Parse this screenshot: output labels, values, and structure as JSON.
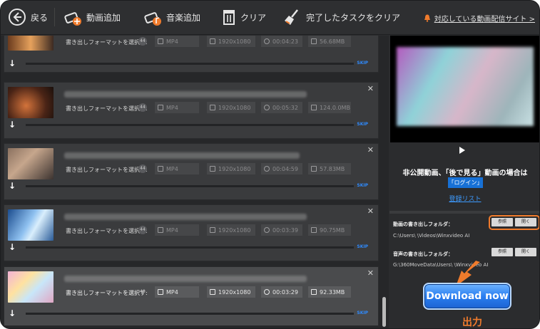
{
  "toolbar": {
    "back_label": "戻る",
    "add_video_label": "動画追加",
    "add_music_label": "音楽追加",
    "clear_label": "クリア",
    "clear_done_label": "完了したタスクをクリア",
    "sites_link": "対応している動画配信サイト >"
  },
  "tasks": [
    {
      "format_select": "書き出しフォーマットを選択す:",
      "badge": "44",
      "format": "MP4",
      "resolution": "1920x1080",
      "duration": "00:04:23",
      "size": "56.68MB",
      "skip": "SKIP"
    },
    {
      "format_select": "書き出しフォーマットを選択す:",
      "badge": "44",
      "format": "MP4",
      "resolution": "1920x1080",
      "duration": "00:05:32",
      "size": "124.0.0MB",
      "skip": "SKIP"
    },
    {
      "format_select": "書き出しフォーマットを選択す:",
      "badge": "44",
      "format": "MP4",
      "resolution": "1920x1080",
      "duration": "00:04:59",
      "size": "57.83MB",
      "skip": "SKIP"
    },
    {
      "format_select": "書き出しフォーマットを選択す:",
      "badge": "44",
      "format": "MP4",
      "resolution": "1920x1080",
      "duration": "00:03:39",
      "size": "90.75MB",
      "skip": "SKIP"
    },
    {
      "format_select": "書き出しフォーマットを選択す:",
      "badge": "43",
      "format": "MP4",
      "resolution": "1920x1080",
      "duration": "00:03:29",
      "size": "92.33MB",
      "skip": "SKIP"
    }
  ],
  "right_panel": {
    "notice": "非公開動画、「後で見る」動画の場合は",
    "login_button": "「ログイン」",
    "watch_list_link": "登録リスト",
    "video_folder_label": "動画の書き出しフォルダ：",
    "video_folder_path": "C:\\Users\\        \\Videos\\Winxvideo AI",
    "audio_folder_label": "音声の書き出しフォルダ：",
    "audio_folder_path": "G:\\360MoveData\\Users\\        \\Winxvideo AI",
    "browse_label": "参照",
    "open_label": "開く",
    "download_button": "Download now",
    "output_caption": "出力"
  },
  "colors": {
    "accent_orange": "#f07b2c",
    "download_blue": "#2a7ef0",
    "skip_blue": "#2f8bff"
  }
}
